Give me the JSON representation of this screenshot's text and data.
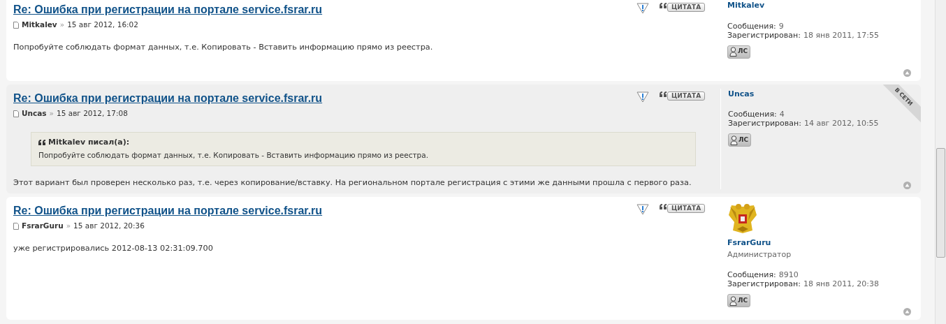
{
  "posts": [
    {
      "title": "Re: Ошибка при регистрации на портале service.fsrar.ru",
      "author": "Mitkalev",
      "separator": "»",
      "date": "15 авг 2012, 16:02",
      "online": false,
      "quote_button": "ЦИТАТА",
      "body": "Попробуйте соблюдать формат данных, т.е. Копировать - Вставить информацию прямо из реестра.",
      "profile": {
        "name": "Mitkalev",
        "stats": [
          {
            "label": "Сообщения:",
            "value": "9"
          },
          {
            "label": "Зарегистрирован:",
            "value": "18 янв 2011, 17:55"
          }
        ],
        "pm_button": "ЛС"
      }
    },
    {
      "title": "Re: Ошибка при регистрации на портале service.fsrar.ru",
      "author": "Uncas",
      "separator": "»",
      "date": "15 авг 2012, 17:08",
      "online": true,
      "online_label": "В СЕТИ",
      "quote_button": "ЦИТАТА",
      "quote": {
        "author": "Mitkalev писал(а):",
        "text": "Попробуйте соблюдать формат данных, т.е. Копировать - Вставить информацию прямо из реестра."
      },
      "body": "Этот вариант был проверен несколько раз, т.е. через копирование/вставку. На региональном портале регистрация с этими же данными прошла с первого раза.",
      "profile": {
        "name": "Uncas",
        "stats": [
          {
            "label": "Сообщения:",
            "value": "4"
          },
          {
            "label": "Зарегистрирован:",
            "value": "14 авг 2012, 10:55"
          }
        ],
        "pm_button": "ЛС"
      }
    },
    {
      "title": "Re: Ошибка при регистрации на портале service.fsrar.ru",
      "author": "FsrarGuru",
      "separator": "»",
      "date": "15 авг 2012, 20:36",
      "online": false,
      "quote_button": "ЦИТАТА",
      "body": "уже регистрировались 2012-08-13 02:31:09.700",
      "profile": {
        "name": "FsrarGuru",
        "rank": "Администратор",
        "stats": [
          {
            "label": "Сообщения:",
            "value": "8910"
          },
          {
            "label": "Зарегистрирован:",
            "value": "18 янв 2011, 20:38"
          }
        ],
        "pm_button": "ЛС"
      }
    }
  ]
}
